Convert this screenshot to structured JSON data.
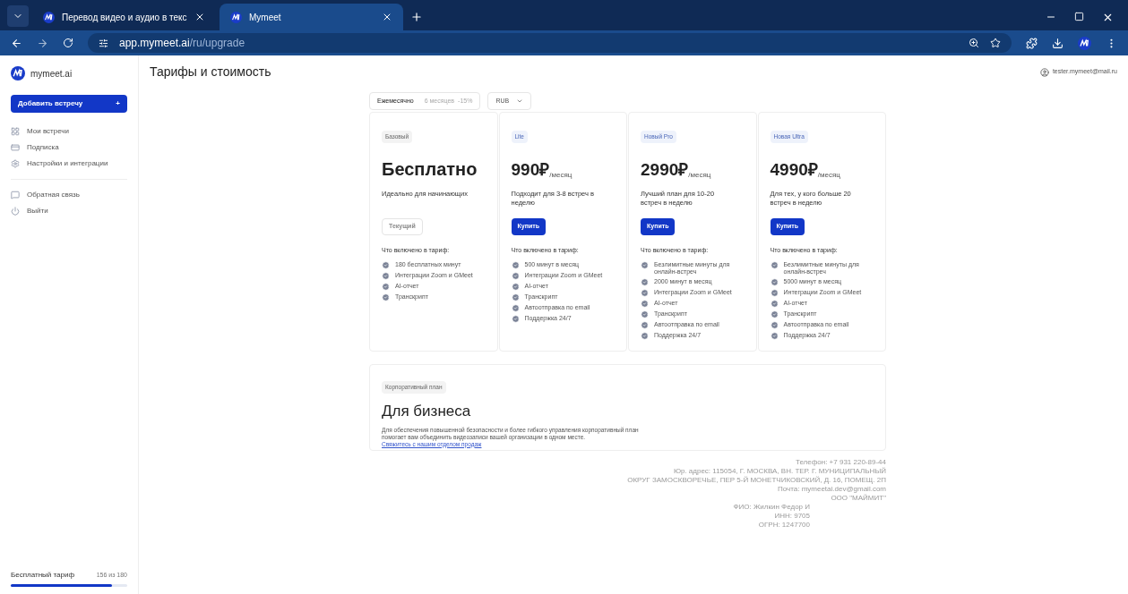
{
  "browser": {
    "tabs": [
      {
        "title": "Перевод видео и аудио в текс",
        "selected": false
      },
      {
        "title": "Mymeet",
        "selected": true
      }
    ],
    "url_host": "app.mymeet.ai",
    "url_path": "/ru/upgrade"
  },
  "sidebar": {
    "logo": "mymeet.ai",
    "add_button": "Добавить встречу",
    "add_icon": "+",
    "items": [
      {
        "label": "Мои встречи",
        "kind": "grid"
      },
      {
        "label": "Подписка",
        "kind": "card"
      },
      {
        "label": "Настройки и интеграции",
        "kind": "gear"
      }
    ],
    "bottom_items": [
      {
        "label": "Обратная связь",
        "kind": "chat"
      },
      {
        "label": "Выйти",
        "kind": "power"
      }
    ],
    "plan": {
      "label": "Бесплатный тариф",
      "count": "156 из 180",
      "level": 0.867
    }
  },
  "page": {
    "title": "Тарифы и стоимость",
    "user": "tester.mymeet@mail.ru"
  },
  "billing": {
    "options": [
      {
        "label": "Ежемесячно",
        "selected": true
      },
      {
        "label": "6 месяцев",
        "badge": "-15%",
        "selected": false
      }
    ],
    "currency": "RUB"
  },
  "plans": [
    {
      "tag": "Базовый",
      "price": "Бесплатно",
      "description": "Идеально для начинающих",
      "button": "Текущий",
      "current": true,
      "features_title": "Что включено в тариф:",
      "features": [
        "180 бесплатных минут",
        "Интеграции Zoom и GMeet",
        "AI-отчет",
        "Транскрипт"
      ]
    },
    {
      "tag": "Lite",
      "price": "990₽",
      "period": "/месяц",
      "description": "Подходит для 3-8 встреч в неделю",
      "button": "Купить",
      "current": false,
      "features_title": "Что включено в тариф:",
      "features": [
        "500 минут в месяц",
        "Интеграции Zoom и GMeet",
        "AI-отчет",
        "Транскрипт",
        "Автоотправка по email",
        "Поддержка 24/7"
      ]
    },
    {
      "tag": "Новый Pro",
      "price": "2990₽",
      "period": "/месяц",
      "description": "Лучший план для 10-20 встреч в неделю",
      "button": "Купить",
      "current": false,
      "features_title": "Что включено в тариф:",
      "features": [
        "Безлимитные минуты для онлайн-встреч",
        "2000 минут в месяц",
        "Интеграции Zoom и GMeet",
        "AI-отчет",
        "Транскрипт",
        "Автоотправка по email",
        "Поддержка 24/7"
      ]
    },
    {
      "tag": "Новая Ultra",
      "price": "4990₽",
      "period": "/месяц",
      "description": "Для тех, у кого больше 20 встреч в неделю",
      "button": "Купить",
      "current": false,
      "features_title": "Что включено в тариф:",
      "features": [
        "Безлимитные минуты для онлайн-встреч",
        "5000 минут в месяц",
        "Интеграции Zoom и GMeet",
        "AI-отчет",
        "Транскрипт",
        "Автоотправка по email",
        "Поддержка 24/7"
      ]
    }
  ],
  "business": {
    "tag": "Корпоративный план",
    "title": "Для бизнеса",
    "text": "Для обеспечения повышенной безопасности и более гибкого управления корпоративный план помогает вам объединить видеозаписи вашей организации в одном месте.",
    "link": "Свяжитесь с нашим отделом продаж"
  },
  "footer": {
    "lines": [
      "Телефон: +7 931 220-89-44",
      "Юр. адрес: 115054, Г. МОСКВА, ВН. ТЕР. Г. МУНИЦИПАЛЬНЫЙ",
      "ОКРУГ ЗАМОСКВОРЕЧЬЕ, ПЕР 5-Й МОНЕТЧИКОВСКИЙ, Д. 16, ПОМЕЩ. 2П",
      "Почта: mymeetai.dev@gmail.com",
      "ООО \"МАЙМИТ\""
    ],
    "cut_lines": [
      "ФИО: Жилкин Федор И",
      "ИНН: 9705",
      "ОГРН: 1247700"
    ]
  }
}
